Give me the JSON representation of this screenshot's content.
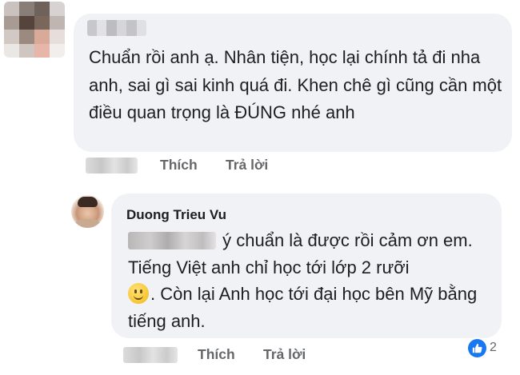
{
  "comment1": {
    "text": "Chuẩn rồi anh ạ. Nhân tiện, học lại chính tả đi nha anh, sai gì sai kinh quá đi. Khen chê gì cũng cần một điều quan trọng là ĐÚNG nhé anh",
    "like_label": "Thích",
    "reply_label": "Trả lời"
  },
  "comment2": {
    "author": "Duong Trieu Vu",
    "text_part1": "ý chuẩn là được rồi cảm ơn em. Tiếng Việt anh chỉ học tới lớp 2 rưỡi",
    "text_part2": ". Còn lại Anh học tới đại học bên Mỹ bằng tiếng anh.",
    "like_label": "Thích",
    "reply_label": "Trả lời",
    "reaction_count": "2",
    "reaction_icon": "like-thumb-icon",
    "reaction_color": "#1877f2"
  },
  "colors": {
    "bubble": "#f0f2f5",
    "text": "#1c1e21",
    "action": "#65676b"
  }
}
